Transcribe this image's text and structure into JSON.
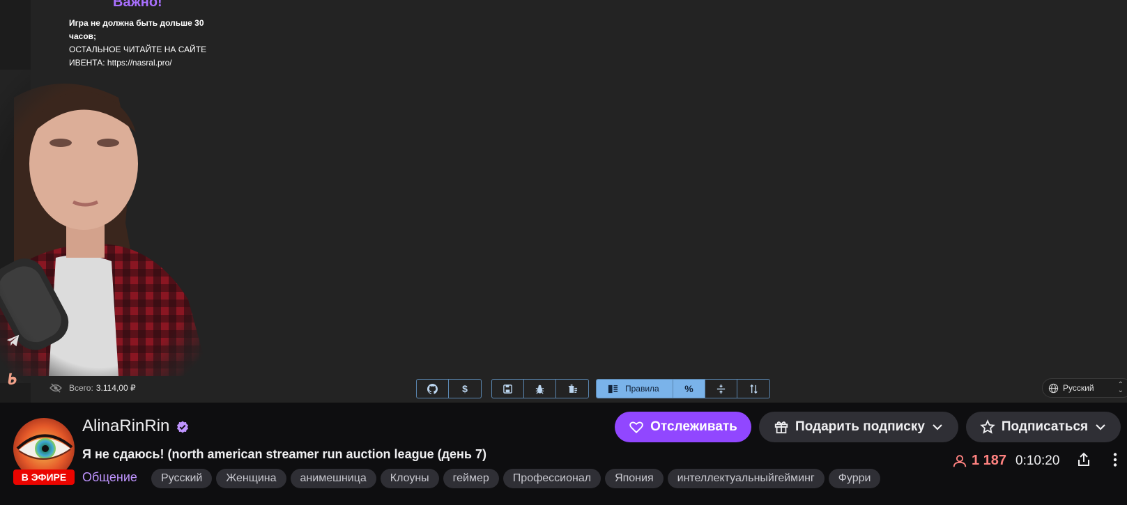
{
  "stream_overlay": {
    "notice_title": "Важно!",
    "notice_line1": "Игра не должна быть дольше 30 часов;",
    "notice_line2": "ОСТАЛЬНОЕ ЧИТАЙТЕ НА САЙТЕ ИВЕНТА: https://nasral.pro/",
    "total_label": "Всего:",
    "total_value": "3.114,00 ₽",
    "toolbar": {
      "rules_label": "Правила",
      "dollar_label": "$",
      "percent_label": "%"
    },
    "language_select": "Русский",
    "toolbar_accent": "#7ab3ea"
  },
  "channel": {
    "name": "AlinaRinRin",
    "live_badge": "В ЭФИРЕ",
    "stream_title": "Я не сдаюсь! (north american streamer run auction league (день 7)",
    "category": "Общение",
    "tags": [
      "Русский",
      "Женщина",
      "анимешница",
      "Клоуны",
      "геймер",
      "Профессионал",
      "Япония",
      "интеллектуальныйгейминг",
      "Фурри"
    ],
    "viewers": "1 187",
    "uptime": "0:10:20"
  },
  "actions": {
    "follow_label": "Отслеживать",
    "gift_label": "Подарить подписку",
    "subscribe_label": "Подписаться"
  },
  "colors": {
    "brand": "#9147ff",
    "live": "#eb0400",
    "viewers": "#ff8280",
    "category": "#bf94ff"
  }
}
